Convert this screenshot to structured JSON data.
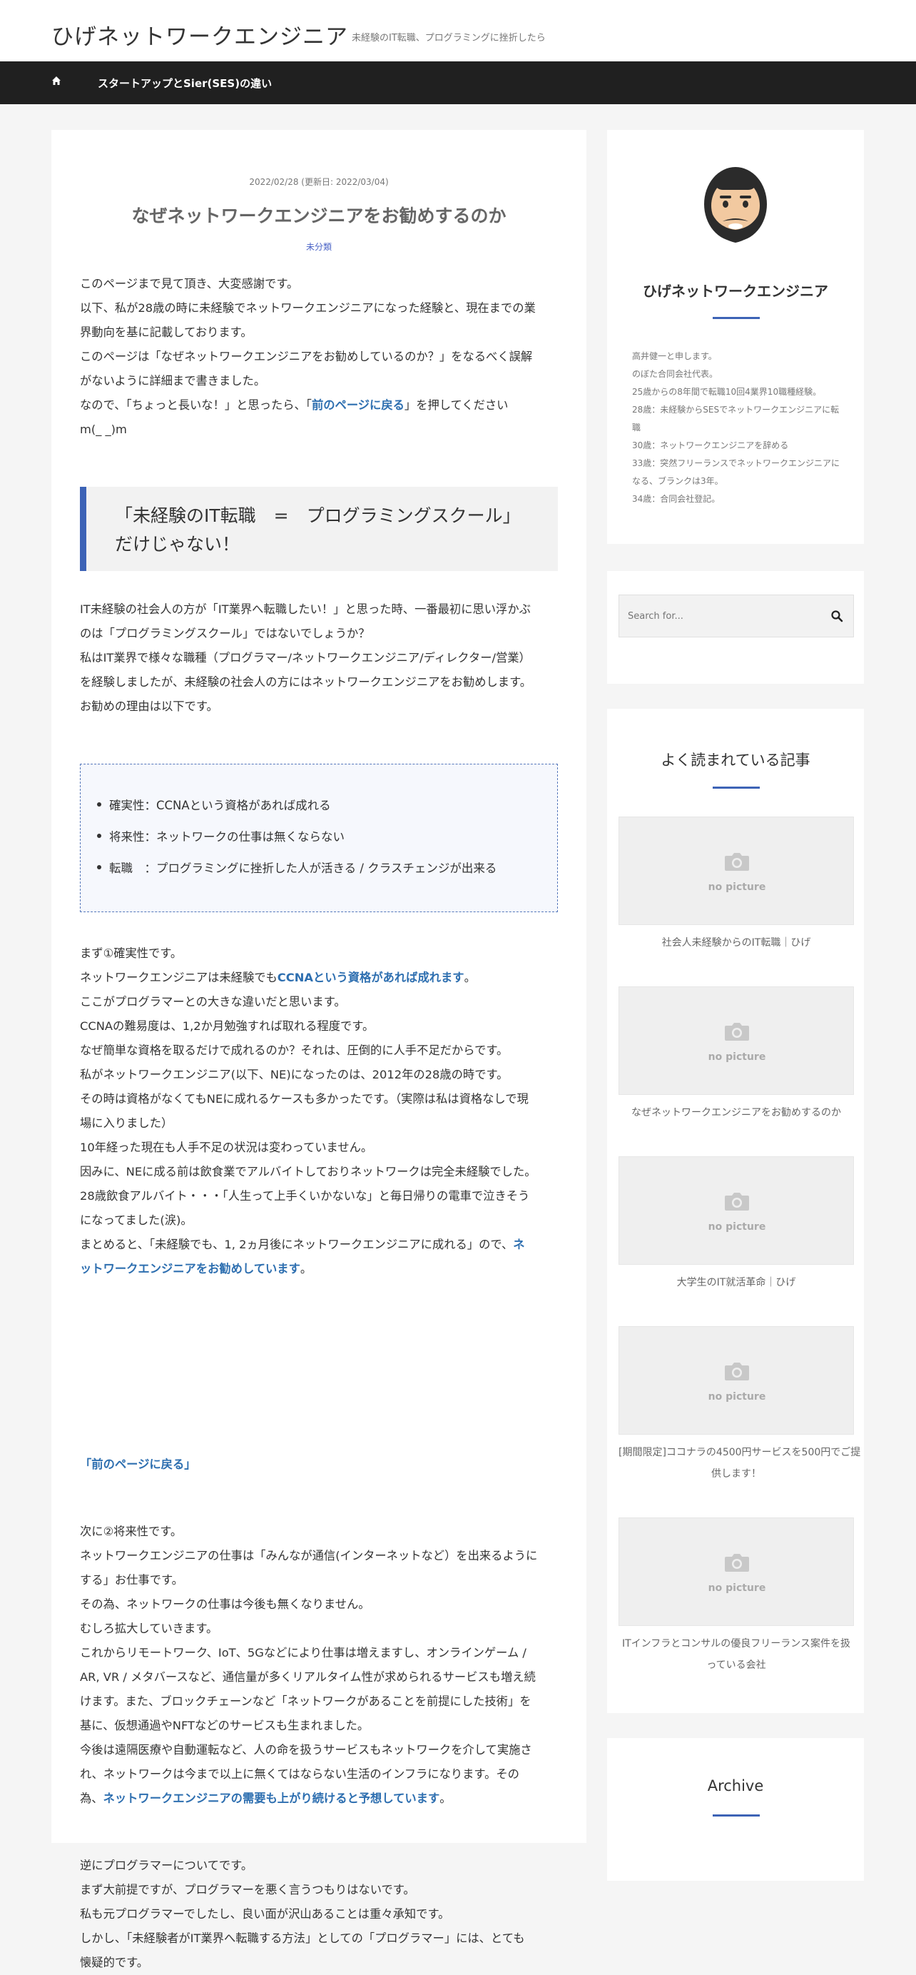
{
  "header": {
    "site_title": "ひげネットワークエンジニア",
    "tagline": "未経験のIT転職、プログラミングに挫折したら"
  },
  "nav": {
    "home_icon": "home-icon",
    "item1": "スタートアップとSier(SES)の違い"
  },
  "post": {
    "date": "2022/02/28 (更新日: 2022/03/04)",
    "title": "なぜネットワークエンジニアをお勧めするのか",
    "category": "未分類",
    "intro": [
      "このページまで見て頂き、大変感謝です。",
      "以下、私が28歳の時に未経験でネットワークエンジニアになった経験と、現在までの業",
      "界動向を基に記載しております。",
      "このページは「なぜネットワークエンジニアをお勧めしているのか？」をなるべく誤解",
      "がないように詳細まで書きました。"
    ],
    "intro_line6_a": "なので、「ちょっと長いな！」と思ったら、「",
    "intro_line6_link": "前のページに戻る",
    "intro_line6_b": "」を押してください",
    "intro_line7": "m(_ _)m",
    "heading_line1": "「未経験のIT転職　=　プログラミングスクール」",
    "heading_line2": "だけじゃない！",
    "section1": [
      "IT未経験の社会人の方が「IT業界へ転職したい！」と思った時、一番最初に思い浮かぶ",
      "のは「プログラミングスクール」ではないでしょうか？",
      "私はIT業界で様々な職種（プログラマー/ネットワークエンジニア/ディレクター/営業）",
      "を経験しましたが、未経験の社会人の方にはネットワークエンジニアをお勧めします。",
      "お勧めの理由は以下です。"
    ],
    "reasons": [
      "確実性：CCNAという資格があれば成れる",
      "将来性：ネットワークの仕事は無くならない",
      "転職　：プログラミングに挫折した人が活きる / クラスチェンジが出来る"
    ],
    "s2_line1": "まず①確実性です。",
    "s2_line2_a": "ネットワークエンジニアは未経験でも",
    "s2_line2_link": "CCNAという資格があれば成れます",
    "s2_line2_b": "。",
    "s2_lines": [
      "ここがプログラマーとの大きな違いだと思います。",
      "CCNAの難易度は、1,2か月勉強すれば取れる程度です。",
      "なぜ簡単な資格を取るだけで成れるのか？それは、圧倒的に人手不足だからです。",
      "私がネットワークエンジニア(以下、NE)になったのは、2012年の28歳の時です。",
      "その時は資格がなくてもNEに成れるケースも多かったです。（実際は私は資格なしで現",
      "場に入りました）",
      "10年経った現在も人手不足の状況は変わっていません。",
      "因みに、NEに成る前は飲食業でアルバイトしておりネットワークは完全未経験でした。",
      "28歳飲食アルバイト・・・「人生って上手くいかないな」と毎日帰りの電車で泣きそう",
      "になってました(涙)。"
    ],
    "s2_last_a": "まとめると、「未経験でも、1, 2ヵ月後にネットワークエンジニアに成れる」ので、",
    "s2_last_link1": "ネ",
    "s2_last_link2": "ットワークエンジニアをお勧めしています",
    "s2_last_b": "。",
    "back_a": "「",
    "back_link": "前のページに戻る",
    "back_b": "」",
    "s3_lines": [
      "次に②将来性です。",
      "ネットワークエンジニアの仕事は「みんなが通信(インターネットなど）を出来るように",
      "する」お仕事です。",
      "その為、ネットワークの仕事は今後も無くなりません。",
      "むしろ拡大していきます。",
      "これからリモートワーク、IoT、5Gなどにより仕事は増えますし、オンラインゲーム /",
      "AR, VR / メタバースなど、通信量が多くリアルタイム性が求められるサービスも増え続",
      "けます。また、ブロックチェーンなど「ネットワークがあることを前提にした技術」を",
      "基に、仮想通過やNFTなどのサービスも生まれました。",
      "今後は遠隔医療や自動運転など、人の命を扱うサービスもネットワークを介して実施さ",
      "れ、ネットワークは今まで以上に無くてはならない生活のインフラになります。その"
    ],
    "s3_last_a": "為、",
    "s3_last_link": "ネットワークエンジニアの需要も上がり続けると予想しています",
    "s3_last_b": "。",
    "s4_lines": [
      "逆にプログラマーについてです。",
      "まず大前提ですが、プログラマーを悪く言うつもりはないです。",
      "私も元プログラマーでしたし、良い面が沢山あることは重々承知です。",
      "しかし、「未経験者がIT業界へ転職する方法」としての「プログラマー」には、とても",
      "懐疑的です。"
    ]
  },
  "sidebar": {
    "profile_name": "ひげネットワークエンジニア",
    "profile_lines": [
      "高井健一と申します。",
      "のぼた合同会社代表。",
      "25歳からの8年間で転職10回4業界10職種経験。",
      "28歳：未経験からSESでネットワークエンジニアに転",
      "職",
      "30歳：ネットワークエンジニアを辞める",
      "33歳：突然フリーランスでネットワークエンジニアに",
      "なる、ブランクは3年。",
      "34歳：合同会社登記。"
    ],
    "search_placeholder": "Search for...",
    "popular_title": "よく読まれている記事",
    "no_picture": "no picture",
    "popular": [
      {
        "lines": [
          "社会人未経験からのIT転職｜ひげ"
        ]
      },
      {
        "lines": [
          "なぜネットワークエンジニアをお勧めするのか"
        ]
      },
      {
        "lines": [
          "大学生のIT就活革命｜ひげ"
        ]
      },
      {
        "lines": [
          "[期間限定]ココナラの4500円サービスを500円でご提",
          "供します！"
        ]
      },
      {
        "lines": [
          "ITインフラとコンサルの優良フリーランス案件を扱",
          "っている会社"
        ]
      }
    ],
    "archive_title": "Archive"
  },
  "colors": {
    "accent": "#3d63b6",
    "link": "#2e6fb0",
    "nav_bg": "#202020"
  }
}
